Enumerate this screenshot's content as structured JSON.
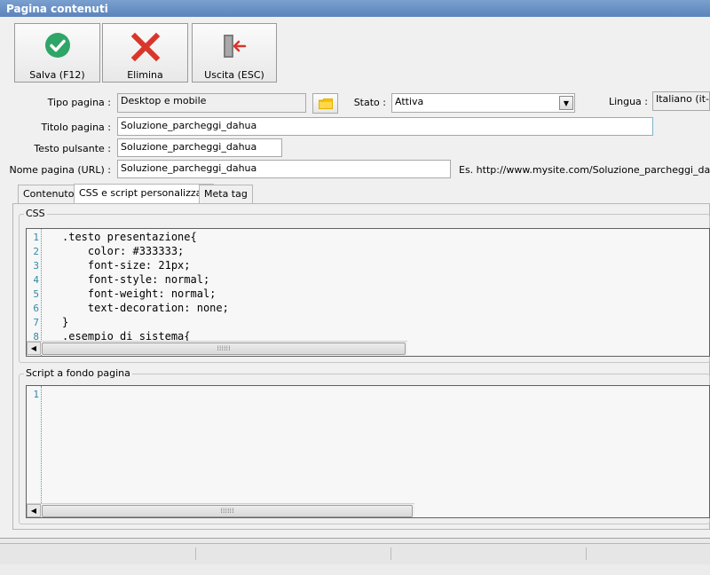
{
  "window": {
    "title": "Pagina contenuti"
  },
  "toolbar": {
    "save_label": "Salva (F12)",
    "delete_label": "Elimina",
    "exit_label": "Uscita (ESC)",
    "save_icon": "check-circle-icon",
    "delete_icon": "red-x-icon",
    "exit_icon": "exit-door-icon"
  },
  "form": {
    "tipo_pagina_label": "Tipo pagina :",
    "tipo_pagina_value": "Desktop e mobile",
    "stato_label": "Stato :",
    "stato_value": "Attiva",
    "lingua_label": "Lingua :",
    "lingua_value": "Italiano (it-IT)",
    "titolo_label": "Titolo pagina :",
    "titolo_value": "Soluzione_parcheggi_dahua",
    "testo_label": "Testo pulsante :",
    "testo_value": "Soluzione_parcheggi_dahua",
    "nome_label": "Nome pagina (URL) :",
    "nome_value": "Soluzione_parcheggi_dahua",
    "url_example": "Es. http://www.mysite.com/Soluzione_parcheggi_dahua"
  },
  "tabs": [
    {
      "label": "Contenuto"
    },
    {
      "label": "CSS e script personalizzati"
    },
    {
      "label": "Meta tag"
    }
  ],
  "css_group": {
    "title": "CSS",
    "line_numbers": [
      "1",
      "2",
      "3",
      "4",
      "5",
      "6",
      "7",
      "8"
    ],
    "lines": [
      ".testo presentazione{",
      "    color: #333333;",
      "    font-size: 21px;",
      "    font-style: normal;",
      "    font-weight: normal;",
      "    text-decoration: none;",
      "}",
      ".esempio di sistema{"
    ]
  },
  "script_group": {
    "title": "Script a fondo pagina",
    "line_numbers": [
      "1"
    ]
  },
  "colors": {
    "titlebar": "#6890c4",
    "line_number": "#2f8aa5",
    "folder_button": "#f5c400"
  }
}
